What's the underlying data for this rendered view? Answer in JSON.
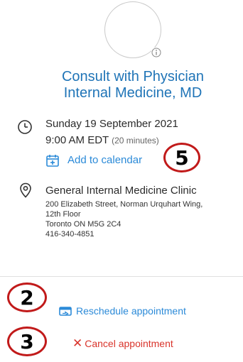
{
  "appointment": {
    "title_line1": "Consult with Physician",
    "title_line2": "Internal Medicine, MD",
    "date": "Sunday 19 September 2021",
    "time": "9:00 AM EDT",
    "duration": "(20 minutes)",
    "add_to_calendar": "Add to calendar"
  },
  "location": {
    "name": "General Internal Medicine Clinic",
    "address_lines": [
      "200 Elizabeth Street, Norman Urquhart Wing,",
      "12th Floor",
      "Toronto ON M5G 2C4",
      "416-340-4851"
    ]
  },
  "actions": {
    "reschedule": "Reschedule appointment",
    "cancel": "Cancel appointment"
  },
  "markers": {
    "m5": "5",
    "m2": "2",
    "m3": "3"
  },
  "colors": {
    "title": "#1f74b7",
    "link": "#2b8ad8",
    "danger": "#d9342b",
    "marker": "#c11a1a"
  },
  "icons": [
    "avatar",
    "info-icon",
    "clock-icon",
    "calendar-icon",
    "map-pin-icon",
    "reschedule-icon",
    "close-icon"
  ]
}
